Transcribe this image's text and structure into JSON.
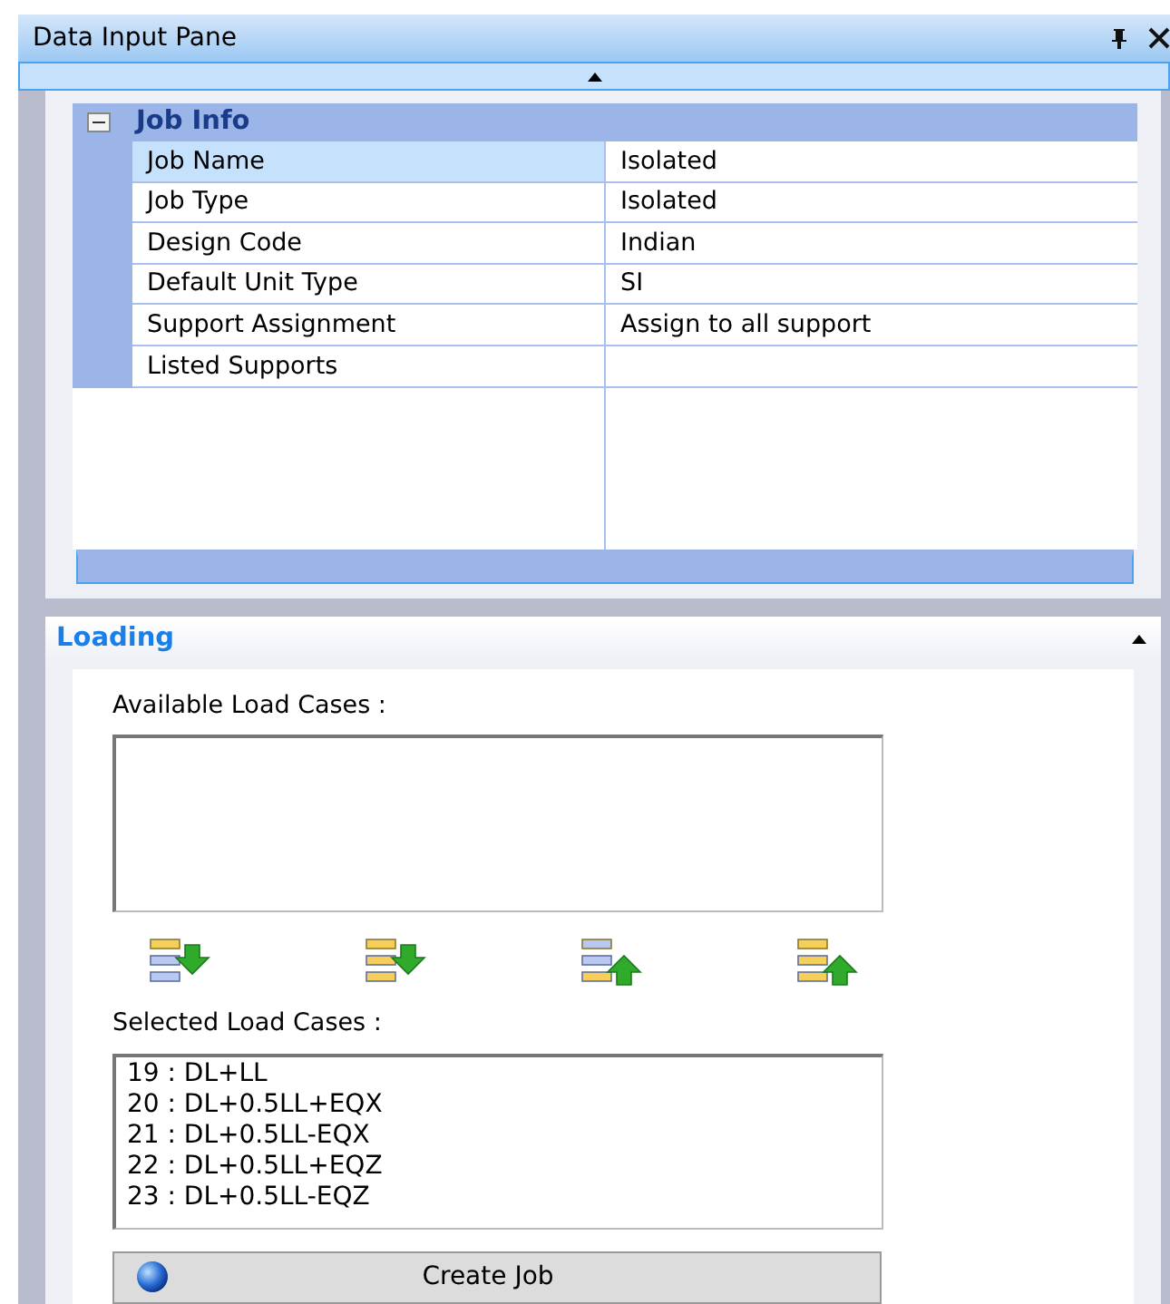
{
  "window": {
    "title": "Data Input Pane"
  },
  "property_grid": {
    "category": {
      "label": "Job Info",
      "expanded": true
    },
    "rows": [
      {
        "name": "Job Name",
        "value": "Isolated",
        "selected": true
      },
      {
        "name": "Job Type",
        "value": "Isolated",
        "selected": false
      },
      {
        "name": "Design Code",
        "value": "Indian",
        "selected": false
      },
      {
        "name": "Default Unit Type",
        "value": "SI",
        "selected": false
      },
      {
        "name": "Support Assignment",
        "value": "Assign to all support",
        "selected": false
      },
      {
        "name": "Listed Supports",
        "selected": false
      }
    ]
  },
  "loading": {
    "title": "Loading",
    "available_load_cases": {
      "label": "Available Load Cases :"
    },
    "selected_load_cases": {
      "label": "Selected Load Cases :",
      "items": [
        "19 : DL+LL",
        "20 : DL+0.5LL+EQX",
        "21 : DL+0.5LL-EQX",
        "22 : DL+0.5LL+EQZ",
        "23 : DL+0.5LL-EQZ"
      ]
    },
    "button": "Create Job"
  }
}
